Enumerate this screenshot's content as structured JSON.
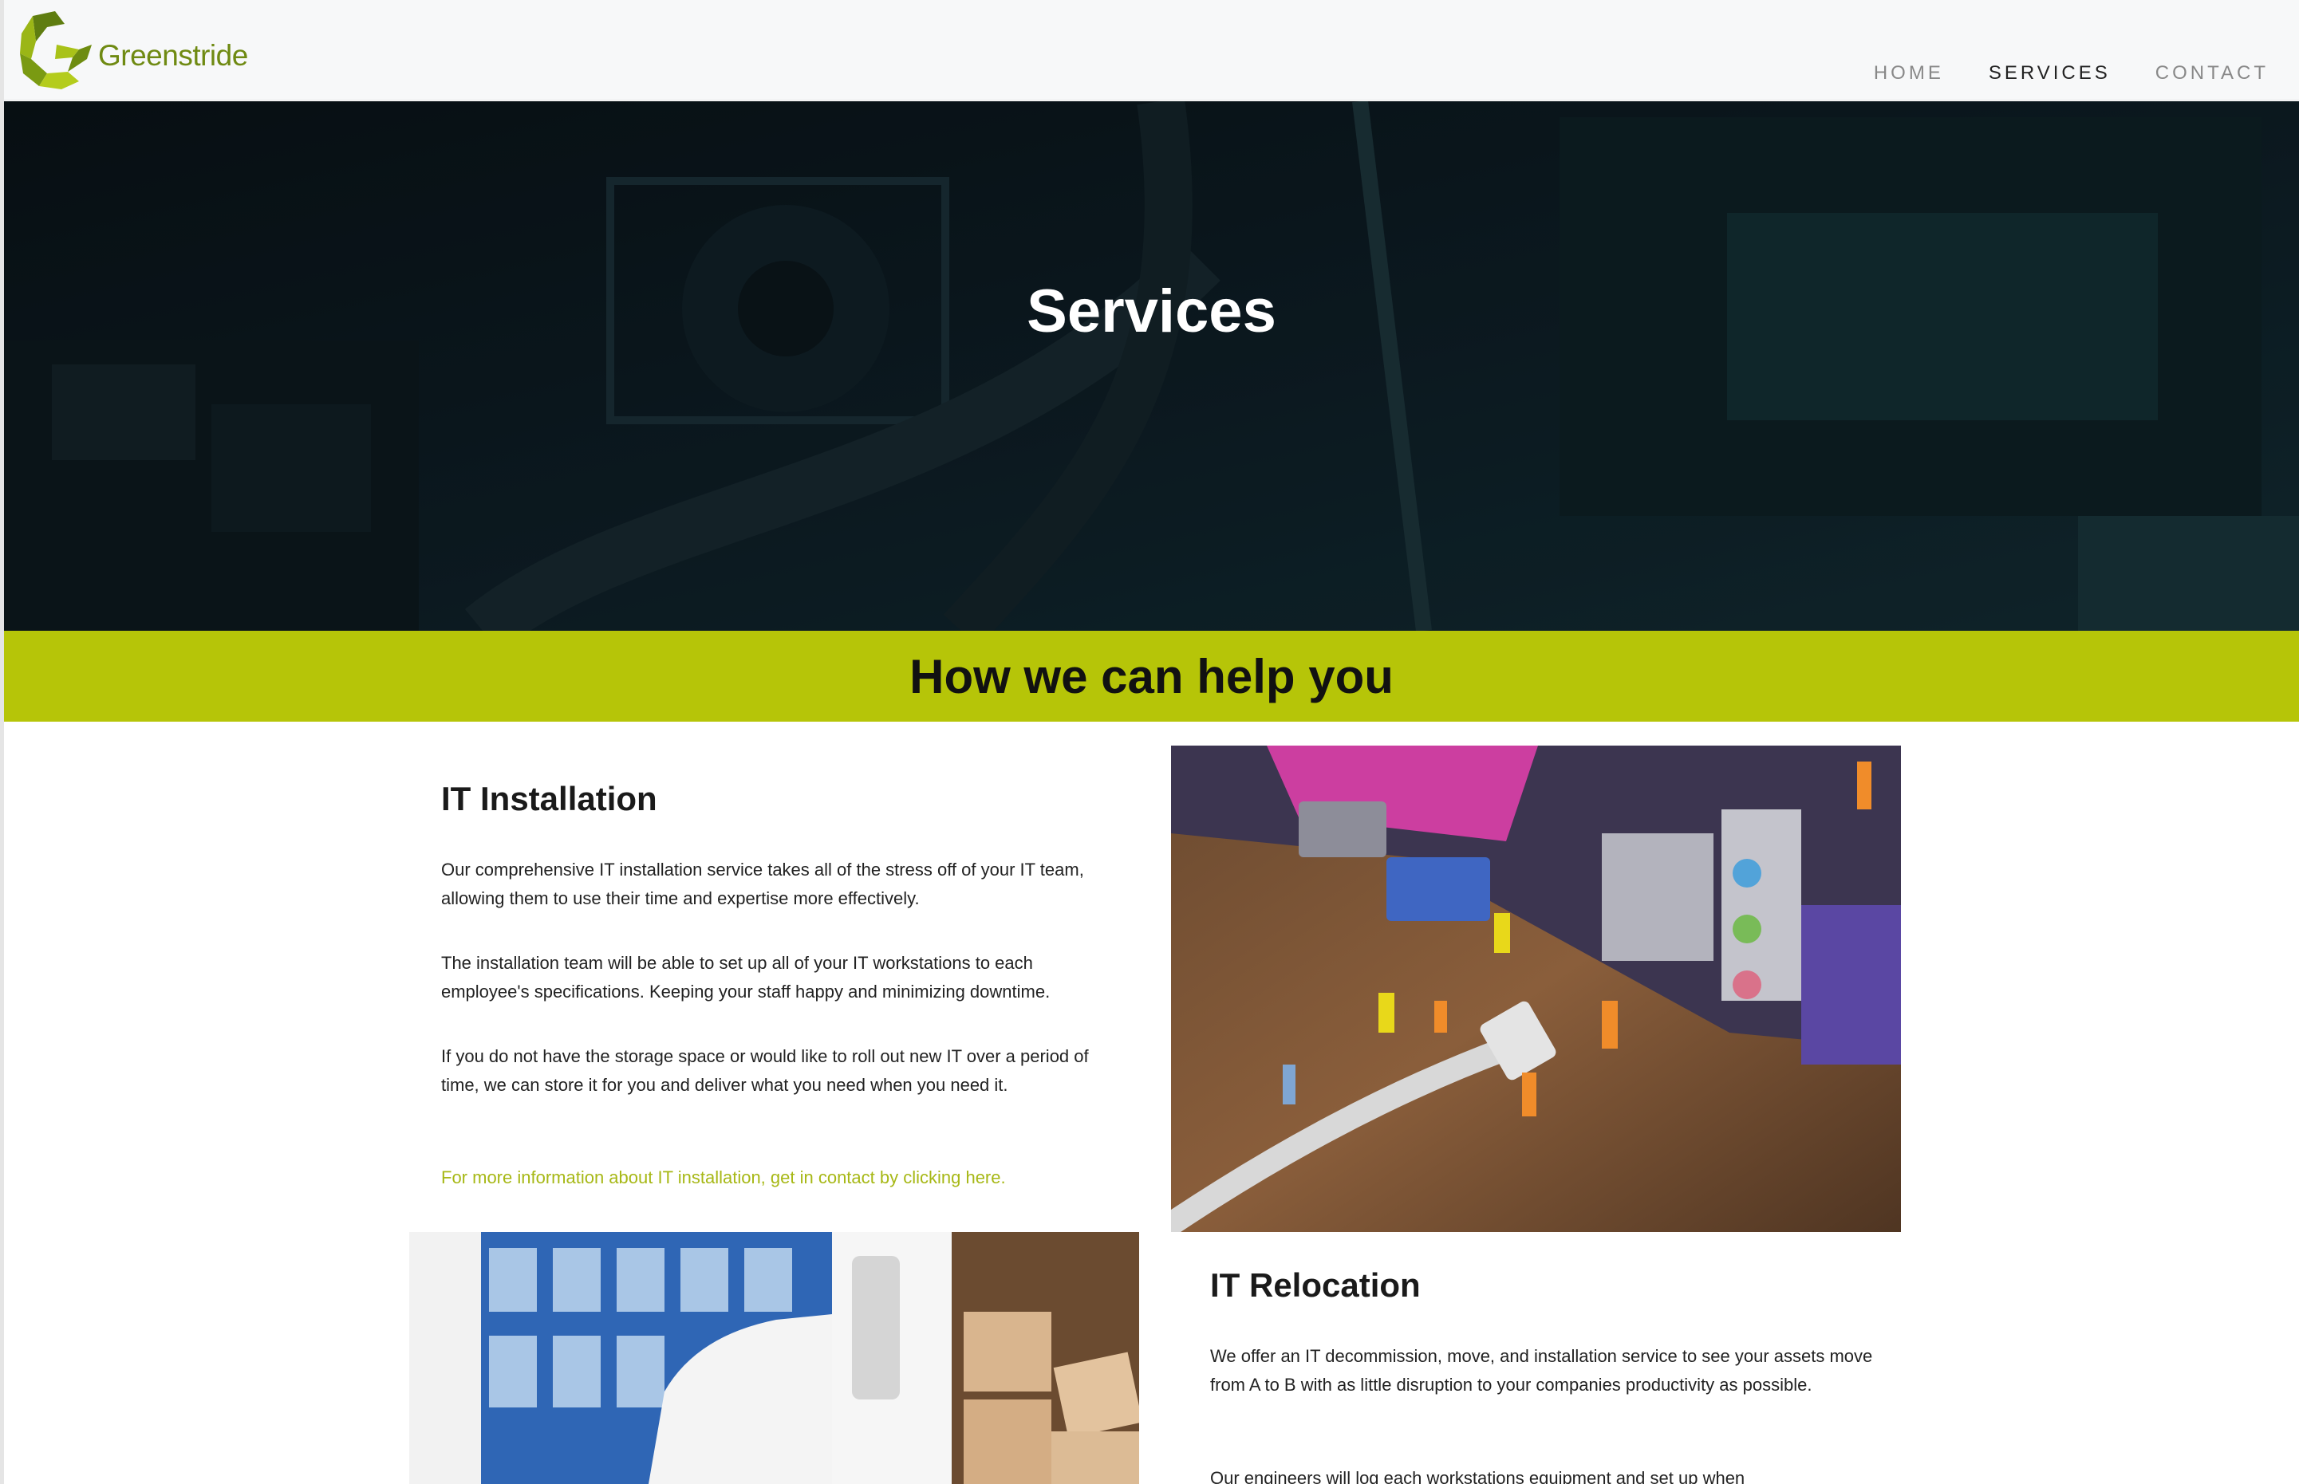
{
  "brand": {
    "name": "Greenstride",
    "logo_icon": "greenstride-logo-icon"
  },
  "nav": {
    "items": [
      {
        "label": "HOME",
        "active": false
      },
      {
        "label": "SERVICES",
        "active": true
      },
      {
        "label": "CONTACT",
        "active": false
      }
    ]
  },
  "hero": {
    "title": "Services"
  },
  "band": {
    "title": "How we can help you",
    "color": "#b6c508"
  },
  "installation": {
    "title": "IT Installation",
    "p1": "Our comprehensive IT installation service takes all of the stress off of your IT team, allowing them to use their time and expertise more effectively.",
    "p2": "The installation team will be able to set up all of your IT workstations to each employee's specifications. Keeping your staff happy and minimizing downtime.",
    "p3": "If you do not have the storage space or would like to roll out new IT over a period of time, we can store it for you and deliver what you need when you need it.",
    "link": "For more information about IT installation, get in contact by clicking here."
  },
  "relocation": {
    "title": "IT Relocation",
    "p1": "We offer an IT decommission, move, and installation service to see your assets move from A to B with as little disruption to your companies productivity as possible.",
    "p2": "Our engineers will log each workstations equipment and set up when"
  },
  "colors": {
    "accent": "#b6c508",
    "link": "#a7b816",
    "brand_text": "#6f8a12"
  }
}
